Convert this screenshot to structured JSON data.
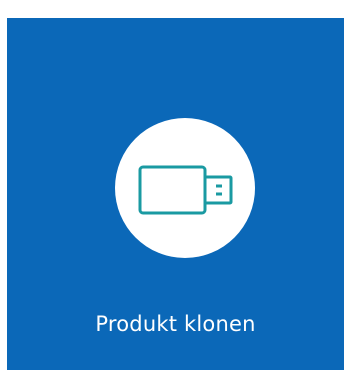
{
  "tile": {
    "label": "Produkt klonen",
    "icon": "usb-drive-icon",
    "background_color": "#0b68b8",
    "icon_circle_color": "#ffffff",
    "icon_color": "#1a9aa2"
  }
}
